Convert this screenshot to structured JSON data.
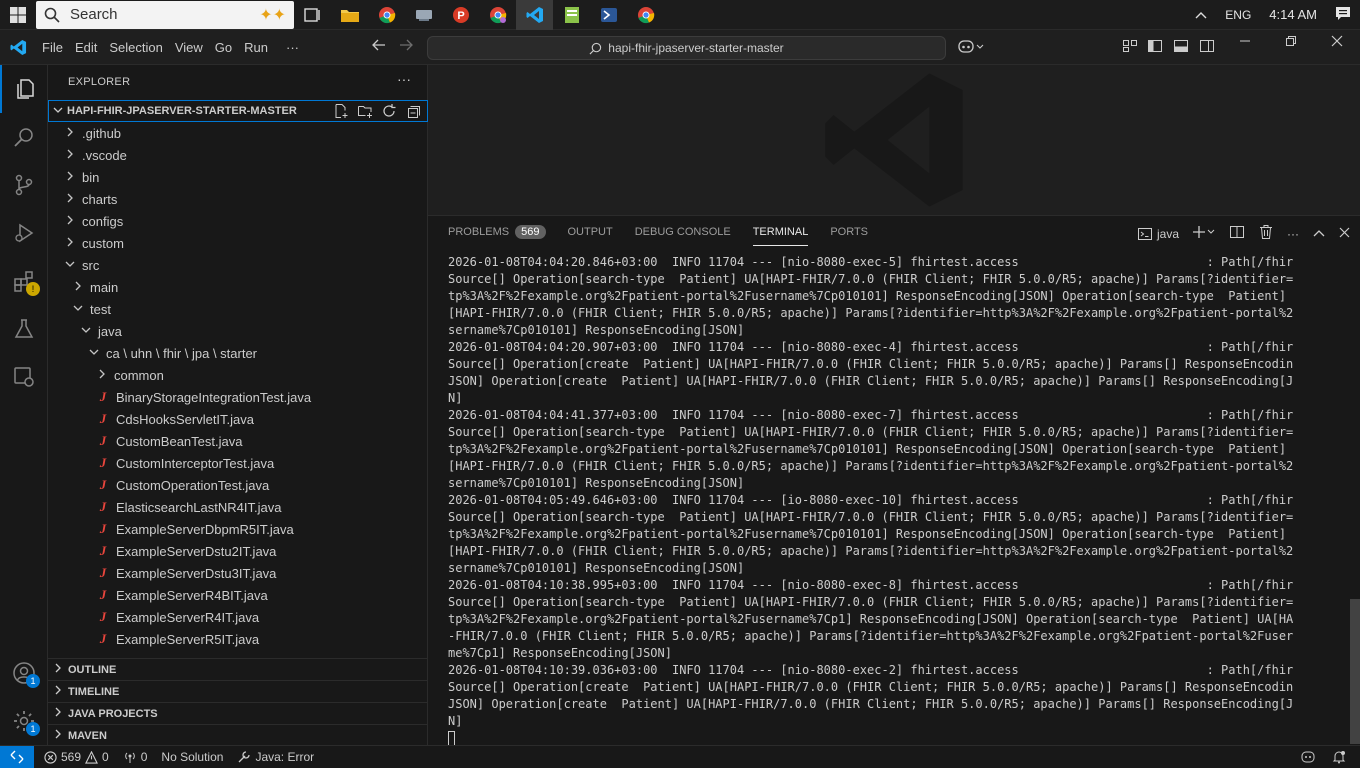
{
  "taskbar": {
    "search_placeholder": "Search",
    "language": "ENG",
    "time": "4:14 AM"
  },
  "titlebar": {
    "menu": [
      "File",
      "Edit",
      "Selection",
      "View",
      "Go",
      "Run",
      "···"
    ],
    "command_center": "hapi-fhir-jpaserver-starter-master"
  },
  "activity": {
    "extensions_badge": "!",
    "accounts_badge": "1",
    "settings_badge": "1"
  },
  "sidebar": {
    "title": "EXPLORER",
    "more": "···",
    "root": "HAPI-FHIR-JPASERVER-STARTER-MASTER",
    "tree": [
      {
        "label": ".github",
        "level": 1,
        "kind": "folder",
        "open": false
      },
      {
        "label": ".vscode",
        "level": 1,
        "kind": "folder",
        "open": false
      },
      {
        "label": "bin",
        "level": 1,
        "kind": "folder",
        "open": false
      },
      {
        "label": "charts",
        "level": 1,
        "kind": "folder",
        "open": false
      },
      {
        "label": "configs",
        "level": 1,
        "kind": "folder",
        "open": false
      },
      {
        "label": "custom",
        "level": 1,
        "kind": "folder",
        "open": false
      },
      {
        "label": "src",
        "level": 1,
        "kind": "folder",
        "open": true
      },
      {
        "label": "main",
        "level": 2,
        "kind": "folder",
        "open": false
      },
      {
        "label": "test",
        "level": 2,
        "kind": "folder",
        "open": true
      },
      {
        "label": "java",
        "level": 3,
        "kind": "folder",
        "open": true
      },
      {
        "label": "ca \\ uhn \\ fhir \\ jpa \\ starter",
        "level": 4,
        "kind": "folder",
        "open": true
      },
      {
        "label": "common",
        "level": 5,
        "kind": "folder",
        "open": false
      },
      {
        "label": "BinaryStorageIntegrationTest.java",
        "level": 5,
        "kind": "java"
      },
      {
        "label": "CdsHooksServletIT.java",
        "level": 5,
        "kind": "java"
      },
      {
        "label": "CustomBeanTest.java",
        "level": 5,
        "kind": "java"
      },
      {
        "label": "CustomInterceptorTest.java",
        "level": 5,
        "kind": "java"
      },
      {
        "label": "CustomOperationTest.java",
        "level": 5,
        "kind": "java"
      },
      {
        "label": "ElasticsearchLastNR4IT.java",
        "level": 5,
        "kind": "java"
      },
      {
        "label": "ExampleServerDbpmR5IT.java",
        "level": 5,
        "kind": "java"
      },
      {
        "label": "ExampleServerDstu2IT.java",
        "level": 5,
        "kind": "java"
      },
      {
        "label": "ExampleServerDstu3IT.java",
        "level": 5,
        "kind": "java"
      },
      {
        "label": "ExampleServerR4BIT.java",
        "level": 5,
        "kind": "java"
      },
      {
        "label": "ExampleServerR4IT.java",
        "level": 5,
        "kind": "java"
      },
      {
        "label": "ExampleServerR5IT.java",
        "level": 5,
        "kind": "java"
      }
    ],
    "sections": [
      "OUTLINE",
      "TIMELINE",
      "JAVA PROJECTS",
      "MAVEN"
    ]
  },
  "panel": {
    "tabs": [
      "PROBLEMS",
      "OUTPUT",
      "DEBUG CONSOLE",
      "TERMINAL",
      "PORTS"
    ],
    "problems_count": "569",
    "terminal_name": "java",
    "terminal_lines": [
      "2026-01-08T04:04:20.846+03:00  INFO 11704 --- [nio-8080-exec-5] fhirtest.access                          : Path[/fhir]",
      "Source[] Operation[search-type  Patient] UA[HAPI-FHIR/7.0.0 (FHIR Client; FHIR 5.0.0/R5; apache)] Params[?identifier=ht",
      "tp%3A%2F%2Fexample.org%2Fpatient-portal%2Fusername%7Cp010101] ResponseEncoding[JSON] Operation[search-type  Patient] UA",
      "[HAPI-FHIR/7.0.0 (FHIR Client; FHIR 5.0.0/R5; apache)] Params[?identifier=http%3A%2F%2Fexample.org%2Fpatient-portal%2Fu",
      "sername%7Cp010101] ResponseEncoding[JSON]",
      "2026-01-08T04:04:20.907+03:00  INFO 11704 --- [nio-8080-exec-4] fhirtest.access                          : Path[/fhir]",
      "Source[] Operation[create  Patient] UA[HAPI-FHIR/7.0.0 (FHIR Client; FHIR 5.0.0/R5; apache)] Params[] ResponseEncoding[",
      "JSON] Operation[create  Patient] UA[HAPI-FHIR/7.0.0 (FHIR Client; FHIR 5.0.0/R5; apache)] Params[] ResponseEncoding[JSO",
      "N]",
      "2026-01-08T04:04:41.377+03:00  INFO 11704 --- [nio-8080-exec-7] fhirtest.access                          : Path[/fhir]",
      "Source[] Operation[search-type  Patient] UA[HAPI-FHIR/7.0.0 (FHIR Client; FHIR 5.0.0/R5; apache)] Params[?identifier=ht",
      "tp%3A%2F%2Fexample.org%2Fpatient-portal%2Fusername%7Cp010101] ResponseEncoding[JSON] Operation[search-type  Patient] UA",
      "[HAPI-FHIR/7.0.0 (FHIR Client; FHIR 5.0.0/R5; apache)] Params[?identifier=http%3A%2F%2Fexample.org%2Fpatient-portal%2Fu",
      "sername%7Cp010101] ResponseEncoding[JSON]",
      "2026-01-08T04:05:49.646+03:00  INFO 11704 --- [io-8080-exec-10] fhirtest.access                          : Path[/fhir]",
      "Source[] Operation[search-type  Patient] UA[HAPI-FHIR/7.0.0 (FHIR Client; FHIR 5.0.0/R5; apache)] Params[?identifier=ht",
      "tp%3A%2F%2Fexample.org%2Fpatient-portal%2Fusername%7Cp010101] ResponseEncoding[JSON] Operation[search-type  Patient] UA",
      "[HAPI-FHIR/7.0.0 (FHIR Client; FHIR 5.0.0/R5; apache)] Params[?identifier=http%3A%2F%2Fexample.org%2Fpatient-portal%2Fu",
      "sername%7Cp010101] ResponseEncoding[JSON]",
      "2026-01-08T04:10:38.995+03:00  INFO 11704 --- [nio-8080-exec-8] fhirtest.access                          : Path[/fhir]",
      "Source[] Operation[search-type  Patient] UA[HAPI-FHIR/7.0.0 (FHIR Client; FHIR 5.0.0/R5; apache)] Params[?identifier=ht",
      "tp%3A%2F%2Fexample.org%2Fpatient-portal%2Fusername%7Cp1] ResponseEncoding[JSON] Operation[search-type  Patient] UA[HAPI",
      "-FHIR/7.0.0 (FHIR Client; FHIR 5.0.0/R5; apache)] Params[?identifier=http%3A%2F%2Fexample.org%2Fpatient-portal%2Fuserna",
      "me%7Cp1] ResponseEncoding[JSON]",
      "2026-01-08T04:10:39.036+03:00  INFO 11704 --- [nio-8080-exec-2] fhirtest.access                          : Path[/fhir]",
      "Source[] Operation[create  Patient] UA[HAPI-FHIR/7.0.0 (FHIR Client; FHIR 5.0.0/R5; apache)] Params[] ResponseEncoding[",
      "JSON] Operation[create  Patient] UA[HAPI-FHIR/7.0.0 (FHIR Client; FHIR 5.0.0/R5; apache)] Params[] ResponseEncoding[JSO",
      "N]"
    ]
  },
  "statusbar": {
    "errors": "569",
    "warnings": "0",
    "ports": "0",
    "solution": "No Solution",
    "java_status": "Java: Error"
  },
  "colors": {
    "accent": "#0078d4",
    "java_icon": "#e8453c"
  }
}
